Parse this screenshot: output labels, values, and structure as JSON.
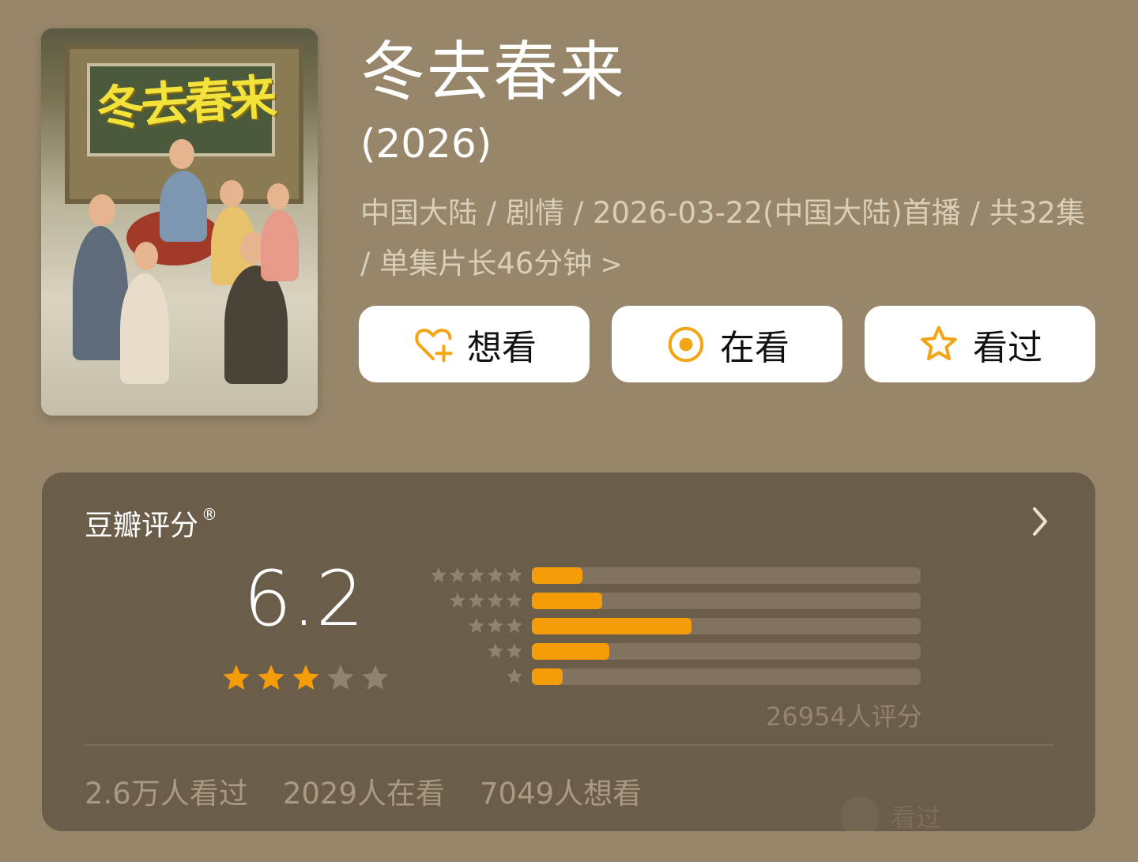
{
  "show": {
    "title": "冬去春来",
    "year": "(2026)",
    "meta_line": "中国大陆 / 剧情 / 2026-03-22(中国大陆)首播 / 共32集 / 单集片长46分钟",
    "meta_chevron": ">",
    "poster_title": "冬去春来"
  },
  "actions": {
    "want": {
      "label": "想看",
      "icon": "heart-plus-icon"
    },
    "watching": {
      "label": "在看",
      "icon": "target-circle-icon"
    },
    "watched": {
      "label": "看过",
      "icon": "star-outline-icon"
    }
  },
  "rating": {
    "title": "豆瓣评分",
    "registered": "®",
    "score": "6.2",
    "stars_filled": 3,
    "stars_total": 5,
    "distribution": [
      {
        "stars": 5,
        "fraction": 0.13
      },
      {
        "stars": 4,
        "fraction": 0.18
      },
      {
        "stars": 3,
        "fraction": 0.41
      },
      {
        "stars": 2,
        "fraction": 0.2
      },
      {
        "stars": 1,
        "fraction": 0.08
      }
    ],
    "count_text": "26954人评分"
  },
  "stats": {
    "watched": "2.6万人看过",
    "watching": "2029人在看",
    "want": "7049人想看"
  },
  "watermark": "看过",
  "colors": {
    "background": "#97866a",
    "card": "#6a5d4a",
    "accent": "#f59d09",
    "star_gray": "#8f8270"
  }
}
